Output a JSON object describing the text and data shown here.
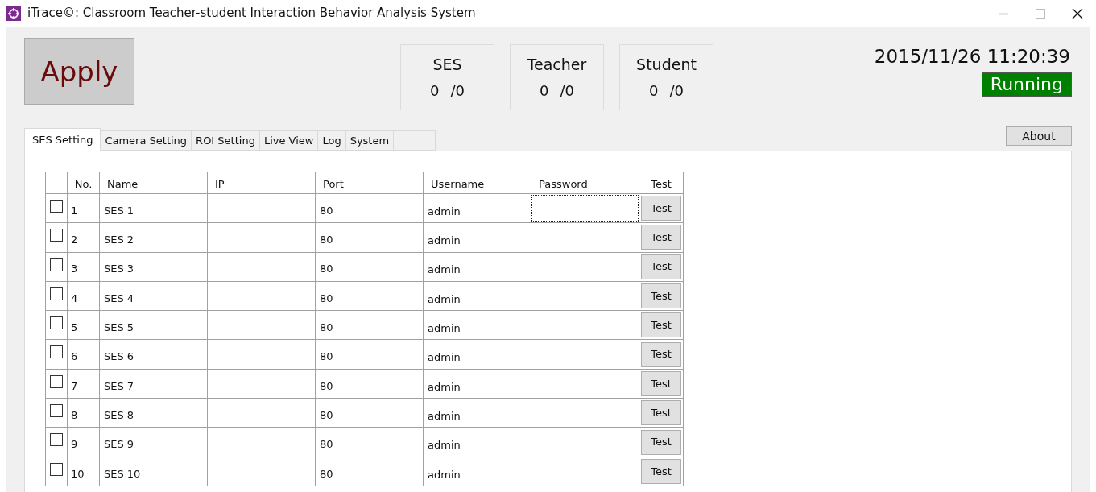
{
  "window": {
    "title": "iTrace©: Classroom Teacher-student Interaction Behavior Analysis System"
  },
  "apply_button": "Apply",
  "counters": [
    {
      "label": "SES",
      "current": "0",
      "total": "/0"
    },
    {
      "label": "Teacher",
      "current": "0",
      "total": "/0"
    },
    {
      "label": "Student",
      "current": "0",
      "total": "/0"
    }
  ],
  "datetime": "2015/11/26 11:20:39",
  "status": "Running",
  "tabs": [
    {
      "label": "SES Setting",
      "selected": true
    },
    {
      "label": "Camera Setting",
      "selected": false
    },
    {
      "label": "ROI Setting",
      "selected": false
    },
    {
      "label": "Live View",
      "selected": false
    },
    {
      "label": "Log",
      "selected": false
    },
    {
      "label": "System",
      "selected": false
    }
  ],
  "about_button": "About",
  "table": {
    "columns": [
      "No.",
      "Name",
      "IP",
      "Port",
      "Username",
      "Password",
      "Test"
    ],
    "rows": [
      {
        "checked": false,
        "no": "1",
        "name": "SES 1",
        "port": "80",
        "username": "admin",
        "password_focused": true,
        "test": "Test"
      },
      {
        "checked": false,
        "no": "2",
        "name": "SES 2",
        "port": "80",
        "username": "admin",
        "password_focused": false,
        "test": "Test"
      },
      {
        "checked": false,
        "no": "3",
        "name": "SES 3",
        "port": "80",
        "username": "admin",
        "password_focused": false,
        "test": "Test"
      },
      {
        "checked": false,
        "no": "4",
        "name": "SES 4",
        "port": "80",
        "username": "admin",
        "password_focused": false,
        "test": "Test"
      },
      {
        "checked": false,
        "no": "5",
        "name": "SES 5",
        "port": "80",
        "username": "admin",
        "password_focused": false,
        "test": "Test"
      },
      {
        "checked": false,
        "no": "6",
        "name": "SES 6",
        "port": "80",
        "username": "admin",
        "password_focused": false,
        "test": "Test"
      },
      {
        "checked": false,
        "no": "7",
        "name": "SES 7",
        "port": "80",
        "username": "admin",
        "password_focused": false,
        "test": "Test"
      },
      {
        "checked": false,
        "no": "8",
        "name": "SES 8",
        "port": "80",
        "username": "admin",
        "password_focused": false,
        "test": "Test"
      },
      {
        "checked": false,
        "no": "9",
        "name": "SES 9",
        "port": "80",
        "username": "admin",
        "password_focused": false,
        "test": "Test"
      },
      {
        "checked": false,
        "no": "10",
        "name": "SES 10",
        "port": "80",
        "username": "admin",
        "password_focused": false,
        "test": "Test"
      }
    ]
  }
}
